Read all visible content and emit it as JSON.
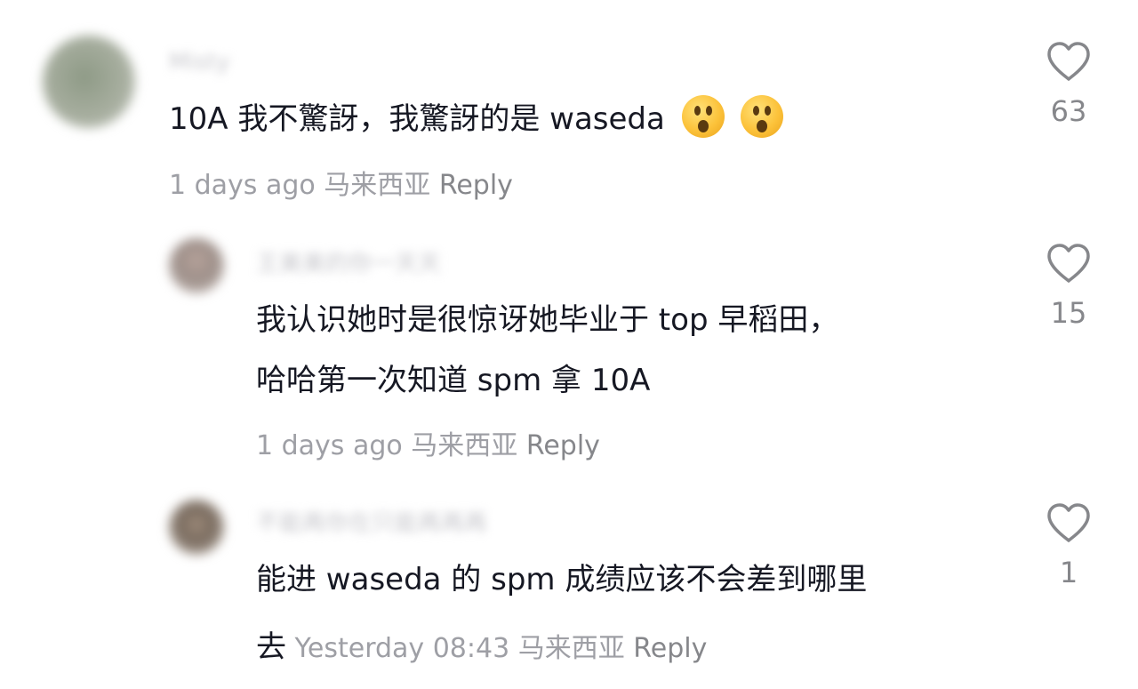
{
  "comments": [
    {
      "username": "Misty",
      "text": "10A 我不驚訝，我驚訝的是 waseda",
      "emojis": [
        "astonished-face-emoji",
        "astonished-face-emoji"
      ],
      "meta": "1 days ago 马来西亚",
      "reply_label": "Reply",
      "likes": "63"
    },
    {
      "username": "王美美的你一天天",
      "text_line1": "我认识她时是很惊讶她毕业于 top 早稻田，",
      "text_line2": "哈哈第一次知道 spm 拿 10A",
      "meta": "1 days ago 马来西亚",
      "reply_label": "Reply",
      "likes": "15"
    },
    {
      "username": "不能再你在只能再再再",
      "text_line1": "能进 waseda 的 spm 成绩应该不会差到哪里",
      "text_line2_prefix": "去",
      "meta": "Yesterday 08:43 马来西亚",
      "reply_label": "Reply",
      "likes": "1"
    }
  ],
  "colors": {
    "text": "#161823",
    "meta": "#9e9fa5",
    "heart_outline": "#86878b"
  },
  "icons": {
    "like": "heart-outline-icon"
  }
}
